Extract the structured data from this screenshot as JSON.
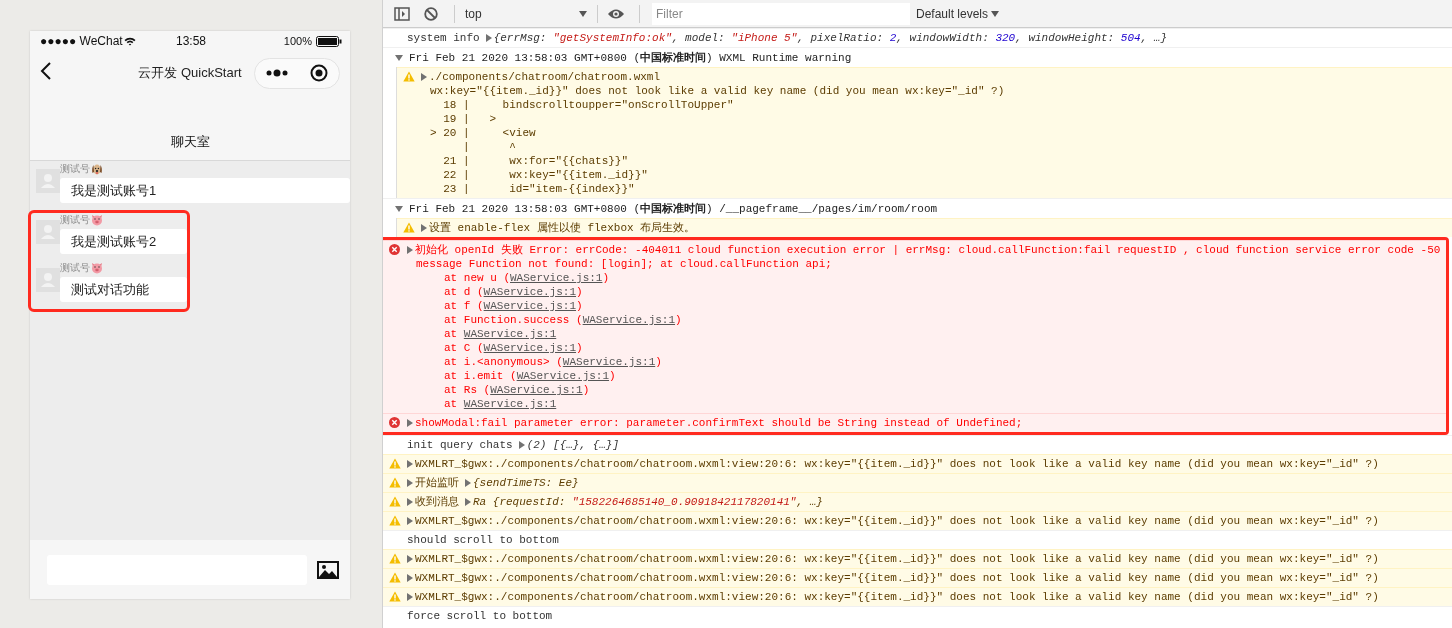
{
  "phone": {
    "status_bar": {
      "carrier": "●●●●● WeChat",
      "time": "13:58",
      "battery": "100%"
    },
    "nav_bar": {
      "title": "云开发 QuickStart"
    },
    "page_title": "聊天室",
    "messages": [
      {
        "sender": "测试号",
        "kind": "dog",
        "text": "我是测试账号1",
        "highlighted": false
      },
      {
        "sender": "测试号",
        "kind": "pig",
        "text": "我是测试账号2",
        "highlighted": true
      },
      {
        "sender": "测试号",
        "kind": "pig",
        "text": "测试对话功能",
        "highlighted": true
      }
    ]
  },
  "devtools": {
    "toolbar": {
      "context": "top",
      "filter_placeholder": "Filter",
      "levels": "Default levels"
    },
    "entries": [
      {
        "kind": "log",
        "text": "system info",
        "preview": [
          {
            "kind": "plain",
            "text": "{errMsg: "
          },
          {
            "kind": "string",
            "text": "\"getSystemInfo:ok\""
          },
          {
            "kind": "plain",
            "text": ", model: "
          },
          {
            "kind": "string",
            "text": "\"iPhone 5\""
          },
          {
            "kind": "plain",
            "text": ", pixelRatio: "
          },
          {
            "kind": "number",
            "text": "2"
          },
          {
            "kind": "plain",
            "text": ", windowWidth: "
          },
          {
            "kind": "number",
            "text": "320"
          },
          {
            "kind": "plain",
            "text": ", windowHeight: "
          },
          {
            "kind": "number",
            "text": "504"
          },
          {
            "kind": "plain",
            "text": ", …}"
          }
        ],
        "highlighted": false
      },
      {
        "kind": "group",
        "expanded": true,
        "text": "Fri Feb 21 2020 13:58:03 GMT+0800 (**中国标准时间**) WXML Runtime warning",
        "highlighted": false,
        "children": [
          {
            "kind": "warning",
            "expanded": false,
            "text": "./components/chatroom/chatroom.wxml",
            "lines": [
              "wx:key=\"{{item._id}}\" does not look like a valid key name (did you mean wx:key=\"_id\" ?)",
              "  18 |     bindscrolltoupper=\"onScrollToUpper\"",
              "  19 |   >",
              "> 20 |     <view",
              "     |      ^",
              "  21 |      wx:for=\"{{chats}}\"",
              "  22 |      wx:key=\"{{item._id}}\"",
              "  23 |      id=\"item-{{index}}\""
            ]
          }
        ]
      },
      {
        "kind": "group",
        "expanded": true,
        "text": "Fri Feb 21 2020 13:58:03 GMT+0800 (**中国标准时间**) /__pageframe__/pages/im/room/room",
        "highlighted": false,
        "children": [
          {
            "kind": "warning",
            "expanded": false,
            "text": "设置 enable-flex 属性以使 flexbox 布局生效。"
          }
        ]
      },
      {
        "kind": "error",
        "expanded": false,
        "text": "初始化 openId 失败 Error: errCode: -404011 cloud function execution error | errMsg: cloud.callFunction:fail requestID , cloud function service error code -50",
        "lines": [
          "message Function not found: [login]; at cloud.callFunction api;"
        ],
        "stack": [
          {
            "prefix": "at new u (",
            "link": "WAService.js:1",
            "suffix": ")"
          },
          {
            "prefix": "at d (",
            "link": "WAService.js:1",
            "suffix": ")"
          },
          {
            "prefix": "at f (",
            "link": "WAService.js:1",
            "suffix": ")"
          },
          {
            "prefix": "at Function.success (",
            "link": "WAService.js:1",
            "suffix": ")"
          },
          {
            "prefix": "at ",
            "link": "WAService.js:1"
          },
          {
            "prefix": "at C (",
            "link": "WAService.js:1",
            "suffix": ")"
          },
          {
            "prefix": "at i.<anonymous> (",
            "link": "WAService.js:1",
            "suffix": ")"
          },
          {
            "prefix": "at i.emit (",
            "link": "WAService.js:1",
            "suffix": ")"
          },
          {
            "prefix": "at Rs (",
            "link": "WAService.js:1",
            "suffix": ")"
          },
          {
            "prefix": "at ",
            "link": "WAService.js:1"
          }
        ],
        "highlighted": true
      },
      {
        "kind": "error",
        "expanded": false,
        "text": "showModal:fail parameter error: parameter.confirmText should be String instead of Undefined;",
        "highlighted": true
      },
      {
        "kind": "log",
        "text": "init query chats",
        "preview": [
          {
            "kind": "plain",
            "text": "(2) [{…}, {…}]"
          }
        ],
        "highlighted": false
      },
      {
        "kind": "warning",
        "expanded": false,
        "text": "WXMLRT_$gwx:./components/chatroom/chatroom.wxml:view:20:6: wx:key=\"{{item._id}}\" does not look like a valid key name (did you mean wx:key=\"_id\" ?)",
        "highlighted": false
      },
      {
        "kind": "warning",
        "expanded": false,
        "text": "开始监听",
        "preview": [
          {
            "kind": "plain",
            "text": "{sendTimeTS: Ee}"
          }
        ],
        "highlighted": false
      },
      {
        "kind": "warning",
        "expanded": false,
        "text": "收到消息",
        "preview": [
          {
            "kind": "plain",
            "text": "Ra {requestId: "
          },
          {
            "kind": "string",
            "text": "\"1582264685140_0.9091842117820141\""
          },
          {
            "kind": "plain",
            "text": ", …}"
          }
        ],
        "highlighted": false
      },
      {
        "kind": "warning",
        "expanded": false,
        "text": "WXMLRT_$gwx:./components/chatroom/chatroom.wxml:view:20:6: wx:key=\"{{item._id}}\" does not look like a valid key name (did you mean wx:key=\"_id\" ?)",
        "highlighted": false
      },
      {
        "kind": "log",
        "text": "should scroll to bottom",
        "highlighted": false
      },
      {
        "kind": "warning",
        "expanded": false,
        "text": "WXMLRT_$gwx:./components/chatroom/chatroom.wxml:view:20:6: wx:key=\"{{item._id}}\" does not look like a valid key name (did you mean wx:key=\"_id\" ?)",
        "highlighted": false
      },
      {
        "kind": "warning",
        "expanded": false,
        "text": "WXMLRT_$gwx:./components/chatroom/chatroom.wxml:view:20:6: wx:key=\"{{item._id}}\" does not look like a valid key name (did you mean wx:key=\"_id\" ?)",
        "highlighted": false
      },
      {
        "kind": "warning",
        "expanded": false,
        "text": "WXMLRT_$gwx:./components/chatroom/chatroom.wxml:view:20:6: wx:key=\"{{item._id}}\" does not look like a valid key name (did you mean wx:key=\"_id\" ?)",
        "highlighted": false
      },
      {
        "kind": "log",
        "text": "force scroll to bottom",
        "highlighted": false
      }
    ]
  }
}
